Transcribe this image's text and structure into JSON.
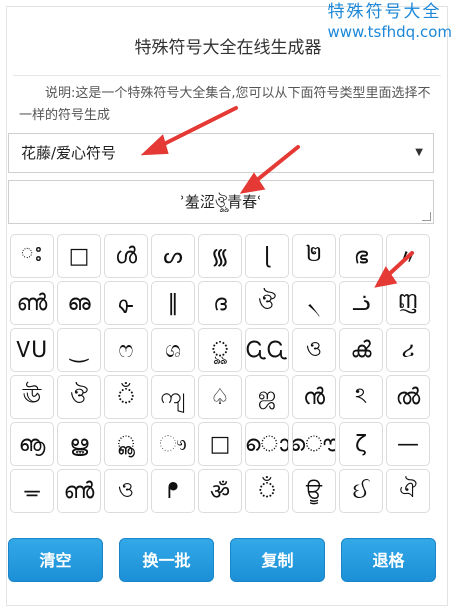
{
  "watermark": {
    "line1": "特殊符号大全",
    "line2": "www.tsfhdq.com"
  },
  "header": {
    "title": "特殊符号大全在线生成器"
  },
  "description": "说明:这是一个特殊符号大全集合,您可以从下面符号类型里面选择不一样的符号生成",
  "category_select": {
    "selected": "花藤/爱心符号"
  },
  "output": {
    "value": "ʾ羞涩ঔৣ青春ʿ"
  },
  "symbols": [
    "ះ",
    "□",
    "ൾ",
    "ᔕ",
    "᯾",
    "ɭ",
    "២",
    "ഭ",
    "〃",
    "ൺ",
    "ഌ",
    "ᡐ",
    "‖",
    "ദ",
    "ঔ",
    "৲",
    "ᓘ",
    "ញ",
    "ᏙU",
    "‿",
    "ෆ",
    "ශ",
    "ৣ",
    "ᏩᏩ",
    "ও",
    "ൿ",
    "ሪ",
    "ঊ",
    "ঔ",
    "ঁ",
    "ကျ",
    "♤",
    "ஜ",
    "ൻ",
    "ঽ",
    "ൽ",
    "ൡ",
    "ൠ",
    "ൣ",
    "ෟ",
    "□",
    "ൊ",
    "ൌ",
    "ζ",
    "—",
    "ᚚ",
    "ൺ",
    "ও",
    "ᖰ",
    "ॐ",
    "ঁ",
    "ਊ",
    "ઈ",
    "ঐ"
  ],
  "buttons": {
    "clear": "清空",
    "refresh": "换一批",
    "copy": "复制",
    "backspace": "退格"
  }
}
